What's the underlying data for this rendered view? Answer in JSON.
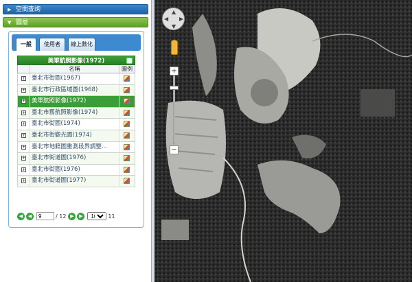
{
  "panel": {
    "query_header": "空間查詢",
    "layers_header": "圖層",
    "tabs": [
      "一般",
      "使用者",
      "線上數化"
    ]
  },
  "grid": {
    "title": "美軍航照影像(1972)",
    "col_name": "名稱",
    "col_legend": "圖例",
    "rows": [
      {
        "name": "臺北市街圖(1967)",
        "selected": false
      },
      {
        "name": "臺北市行政區域圖(1968)",
        "selected": false
      },
      {
        "name": "美軍航照影像(1972)",
        "selected": true
      },
      {
        "name": "臺北市舊航照影像(1974)",
        "selected": false
      },
      {
        "name": "臺北市街圖(1974)",
        "selected": false
      },
      {
        "name": "臺北市街觀光圖(1974)",
        "selected": false
      },
      {
        "name": "臺北市地籍圖重測段界調整...",
        "selected": false
      },
      {
        "name": "臺北市街道圖(1976)",
        "selected": false
      },
      {
        "name": "臺北市街圖(1976)",
        "selected": false
      },
      {
        "name": "臺北市街道圖(1977)",
        "selected": false
      }
    ]
  },
  "pager": {
    "page": "9",
    "total": "/ 12",
    "page_size": "10",
    "count": "11"
  },
  "map": {
    "zoom_in": "+",
    "zoom_out": "−"
  },
  "colors": {
    "blue_header": "#2a73b8",
    "green_header": "#6aad32",
    "selected_row": "#3b9c3a"
  }
}
